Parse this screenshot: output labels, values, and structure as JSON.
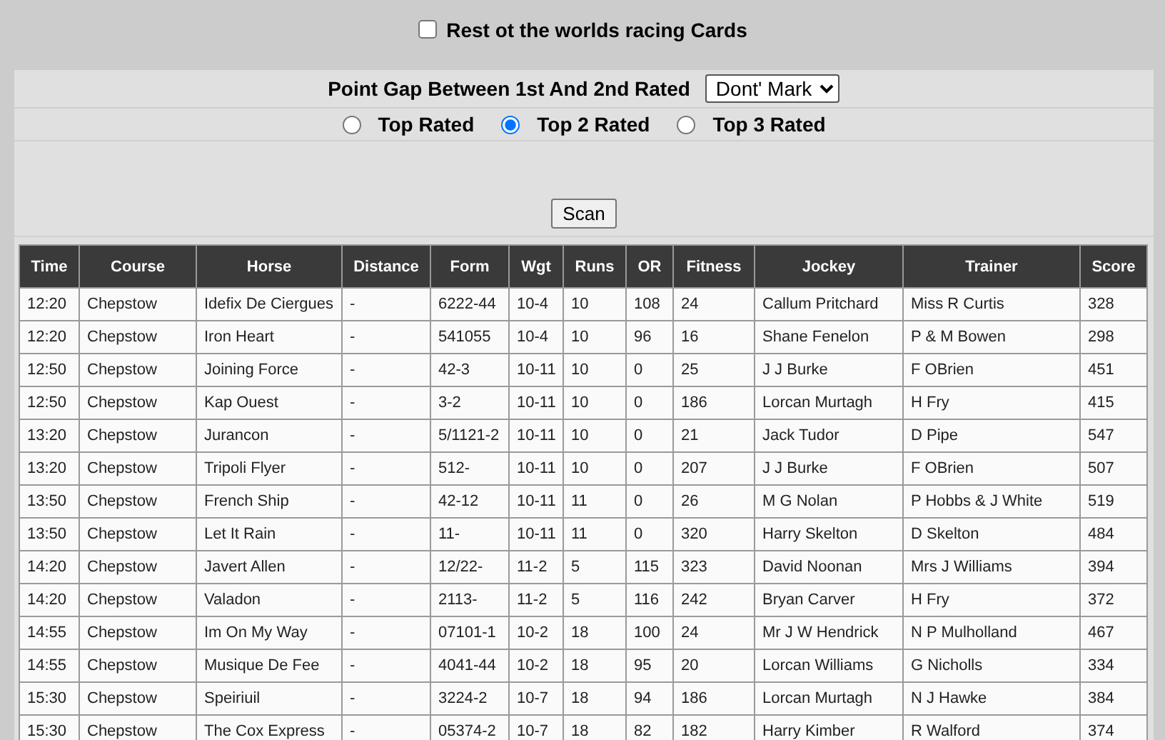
{
  "rest_of_world": {
    "label": "Rest ot the worlds racing Cards",
    "checked": false
  },
  "point_gap": {
    "label": "Point Gap Between 1st And 2nd Rated",
    "value": "Dont' Mark"
  },
  "rated_options": [
    {
      "label": "Top Rated",
      "selected": false
    },
    {
      "label": "Top 2 Rated",
      "selected": true
    },
    {
      "label": "Top 3 Rated",
      "selected": false
    }
  ],
  "scan_button": "Scan",
  "table": {
    "columns": [
      "Time",
      "Course",
      "Horse",
      "Distance",
      "Form",
      "Wgt",
      "Runs",
      "OR",
      "Fitness",
      "Jockey",
      "Trainer",
      "Score"
    ],
    "rows": [
      [
        "12:20",
        "Chepstow",
        "Idefix De Ciergues",
        "-",
        "6222-44",
        "10-4",
        "10",
        "108",
        "24",
        "Callum Pritchard",
        "Miss R Curtis",
        "328"
      ],
      [
        "12:20",
        "Chepstow",
        "Iron Heart",
        "-",
        "541055",
        "10-4",
        "10",
        "96",
        "16",
        "Shane Fenelon",
        "P & M Bowen",
        "298"
      ],
      [
        "12:50",
        "Chepstow",
        "Joining Force",
        "-",
        "42-3",
        "10-11",
        "10",
        "0",
        "25",
        "J J Burke",
        "F OBrien",
        "451"
      ],
      [
        "12:50",
        "Chepstow",
        "Kap Ouest",
        "-",
        "3-2",
        "10-11",
        "10",
        "0",
        "186",
        "Lorcan Murtagh",
        "H Fry",
        "415"
      ],
      [
        "13:20",
        "Chepstow",
        "Jurancon",
        "-",
        "5/1121-2",
        "10-11",
        "10",
        "0",
        "21",
        "Jack Tudor",
        "D Pipe",
        "547"
      ],
      [
        "13:20",
        "Chepstow",
        "Tripoli Flyer",
        "-",
        "512-",
        "10-11",
        "10",
        "0",
        "207",
        "J J Burke",
        "F OBrien",
        "507"
      ],
      [
        "13:50",
        "Chepstow",
        "French Ship",
        "-",
        "42-12",
        "10-11",
        "11",
        "0",
        "26",
        "M G Nolan",
        "P Hobbs & J White",
        "519"
      ],
      [
        "13:50",
        "Chepstow",
        "Let It Rain",
        "-",
        "11-",
        "10-11",
        "11",
        "0",
        "320",
        "Harry Skelton",
        "D Skelton",
        "484"
      ],
      [
        "14:20",
        "Chepstow",
        "Javert Allen",
        "-",
        "12/22-",
        "11-2",
        "5",
        "115",
        "323",
        "David Noonan",
        "Mrs J Williams",
        "394"
      ],
      [
        "14:20",
        "Chepstow",
        "Valadon",
        "-",
        "2113-",
        "11-2",
        "5",
        "116",
        "242",
        "Bryan Carver",
        "H Fry",
        "372"
      ],
      [
        "14:55",
        "Chepstow",
        "Im On My Way",
        "-",
        "07101-1",
        "10-2",
        "18",
        "100",
        "24",
        "Mr J W Hendrick",
        "N P Mulholland",
        "467"
      ],
      [
        "14:55",
        "Chepstow",
        "Musique De Fee",
        "-",
        "4041-44",
        "10-2",
        "18",
        "95",
        "20",
        "Lorcan Williams",
        "G Nicholls",
        "334"
      ],
      [
        "15:30",
        "Chepstow",
        "Speiriuil",
        "-",
        "3224-2",
        "10-7",
        "18",
        "94",
        "186",
        "Lorcan Murtagh",
        "N J Hawke",
        "384"
      ],
      [
        "15:30",
        "Chepstow",
        "The Cox Express",
        "-",
        "05374-2",
        "10-7",
        "18",
        "82",
        "182",
        "Harry Kimber",
        "R Walford",
        "374"
      ]
    ]
  }
}
